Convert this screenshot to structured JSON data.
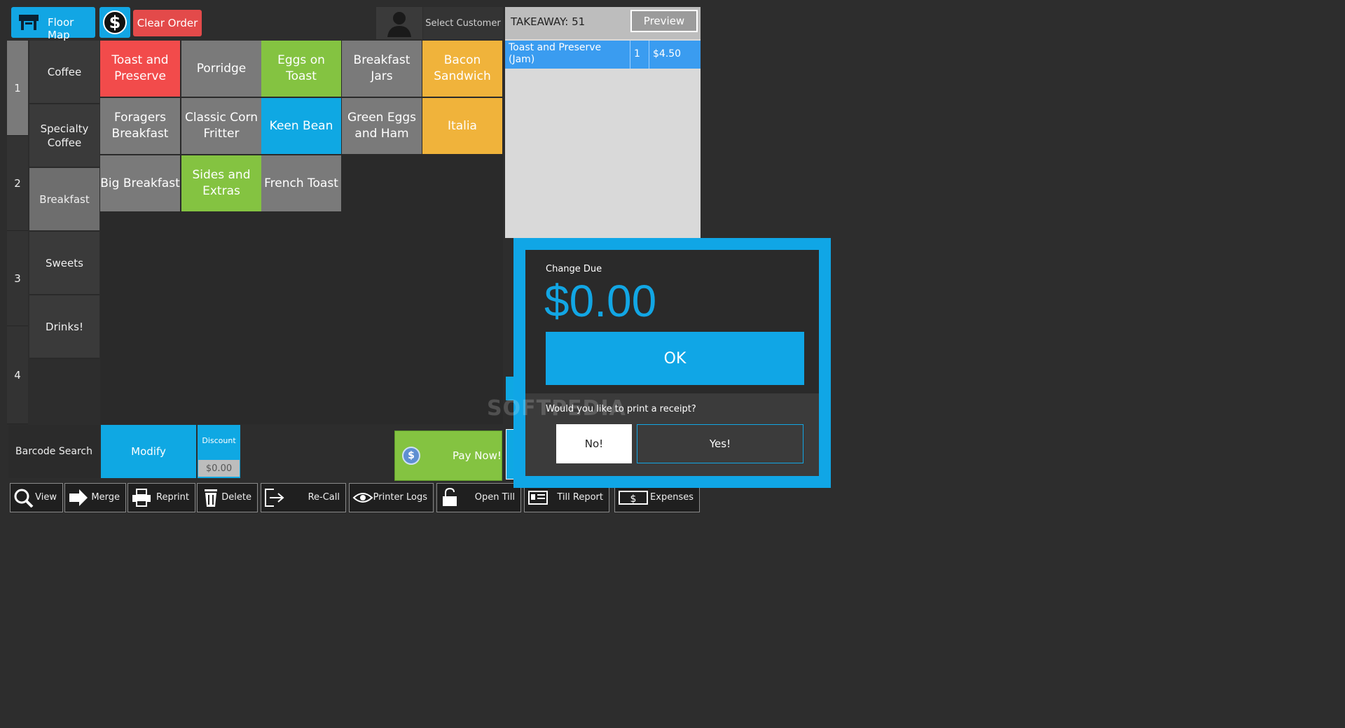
{
  "header": {
    "floor_map": "Floor Map",
    "clear_order": "Clear Order",
    "select_customer": "Select Customer",
    "dollar_symbol": "$"
  },
  "pages": [
    "1",
    "2",
    "3",
    "4"
  ],
  "categories": [
    {
      "label": "Coffee"
    },
    {
      "label": "Specialty Coffee"
    },
    {
      "label": "Breakfast",
      "active": true
    },
    {
      "label": "Sweets"
    },
    {
      "label": "Drinks!"
    }
  ],
  "products": [
    {
      "label": "Toast and Preserve",
      "color": "#f24b4b"
    },
    {
      "label": "Porridge",
      "color": "#7a7a7a"
    },
    {
      "label": "Eggs on Toast",
      "color": "#84c341"
    },
    {
      "label": "Breakfast Jars",
      "color": "#7a7a7a"
    },
    {
      "label": "Bacon Sandwich",
      "color": "#f0b33b"
    },
    {
      "label": "Foragers Breakfast",
      "color": "#7a7a7a"
    },
    {
      "label": "Classic Corn Fritter",
      "color": "#7a7a7a"
    },
    {
      "label": "Keen Bean",
      "color": "#0fa8e3"
    },
    {
      "label": "Green Eggs and Ham",
      "color": "#7a7a7a"
    },
    {
      "label": "Italia",
      "color": "#f0b33b"
    },
    {
      "label": "Big Breakfast",
      "color": "#7a7a7a"
    },
    {
      "label": "Sides and Extras",
      "color": "#84c341"
    },
    {
      "label": "French Toast",
      "color": "#7a7a7a"
    }
  ],
  "controls": {
    "barcode_search": "Barcode Search",
    "modify": "Modify",
    "discount_label": "Discount",
    "discount_value": "$0.00",
    "pay_now": "Pay Now!",
    "pay_icon": "$"
  },
  "toolbar": [
    {
      "label": "View",
      "icon": "magnifier-icon"
    },
    {
      "label": "Merge",
      "icon": "arrow-icon"
    },
    {
      "label": "Reprint",
      "icon": "printer-icon"
    },
    {
      "label": "Delete",
      "icon": "trash-icon"
    },
    {
      "label": "Re-Call",
      "icon": "exit-icon"
    },
    {
      "label": "Printer Logs",
      "icon": "eye-icon"
    },
    {
      "label": "Open Till",
      "icon": "unlock-icon"
    },
    {
      "label": "Till Report",
      "icon": "report-icon"
    },
    {
      "label": "Expenses",
      "icon": "cash-icon"
    }
  ],
  "order": {
    "title": "TAKEAWAY: 51",
    "preview": "Preview",
    "items": [
      {
        "name": "Toast and Preserve (Jam)",
        "qty": "1",
        "price": "$4.50"
      }
    ]
  },
  "dialog": {
    "change_due_label": "Change Due",
    "change_due_amount": "$0.00",
    "ok": "OK",
    "receipt_question": "Would you like to print a receipt?",
    "no": "No!",
    "yes": "Yes!"
  },
  "watermark": "SOFTPEDIA",
  "colors": {
    "accent_blue": "#10a6e6",
    "red": "#f24b4b",
    "green": "#84c341",
    "orange": "#f0b33b",
    "gray": "#7a7a7a",
    "background": "#2d2d2d"
  }
}
